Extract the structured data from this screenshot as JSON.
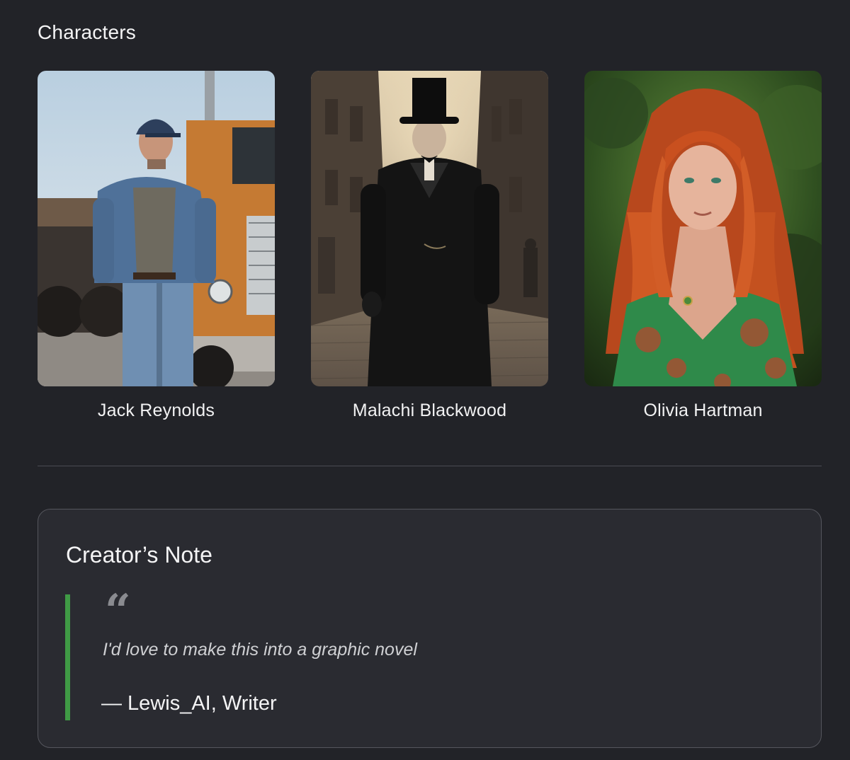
{
  "characters_section": {
    "title": "Characters",
    "cards": [
      {
        "name": "Jack Reynolds",
        "image": "man-denim-jacket-truck-photo"
      },
      {
        "name": "Malachi Blackwood",
        "image": "man-top-hat-dark-coat-photo"
      },
      {
        "name": "Olivia Hartman",
        "image": "red-haired-woman-green-dress-photo"
      }
    ]
  },
  "creator_note": {
    "title": "Creator’s Note",
    "quote_icon": "quote-icon",
    "quote": "I'd love to make this into a graphic novel",
    "author": "— Lewis_AI, Writer"
  },
  "colors": {
    "background": "#222328",
    "accent_bar": "#3f9a45",
    "panel": "#2a2b31"
  }
}
